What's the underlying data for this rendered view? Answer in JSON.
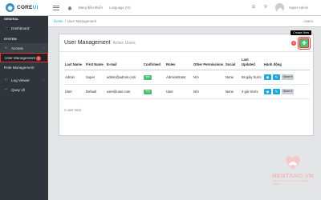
{
  "header": {
    "brand": "CORE",
    "brand_accent": "UI",
    "dashboard_link": "Bảng điều khiển",
    "language": "Language (VI)",
    "user": "Super Admin"
  },
  "sidebar": {
    "section_general": "GENERAL",
    "dashboard": "Dashboard",
    "section_system": "SYSTEM",
    "access": "Access",
    "user_management": "User Management",
    "user_management_badge": "1",
    "role_management": "Role Management",
    "log_viewer": "Log Viewer",
    "back": "Quay về"
  },
  "breadcrumb": {
    "home": "Home",
    "separator": "/",
    "current": "User Management",
    "right": "Users"
  },
  "card": {
    "title": "User Management",
    "subtitle": "Active Users",
    "tooltip": "Create New",
    "step_badge": "2",
    "footnote": "2 user total"
  },
  "table": {
    "headers": [
      "Last Name",
      "First Name",
      "E-mail",
      "Confirmed",
      "Roles",
      "Other Permissions",
      "Social",
      "Last Updated",
      "Hành động"
    ],
    "rows": [
      {
        "last": "Admin",
        "first": "Super",
        "email": "admin@admin.com",
        "confirmed": "Yes",
        "roles": "Administrator",
        "perms": "N/A",
        "social": "None",
        "updated": "59 giây trước",
        "more": "More"
      },
      {
        "last": "User",
        "first": "Default",
        "email": "user@user.com",
        "confirmed": "Yes",
        "roles": "User",
        "perms": "N/A",
        "social": "None",
        "updated": "3 giờ trước",
        "more": "More"
      }
    ]
  },
  "watermark": {
    "text": "NENTANG.VN",
    "sub": "NEN TANG CHO NHUNG THANH CONG"
  },
  "colors": {
    "primary": "#20a8d8",
    "success": "#4dbd74",
    "danger": "#e55353",
    "sidebar": "#2f353a"
  }
}
